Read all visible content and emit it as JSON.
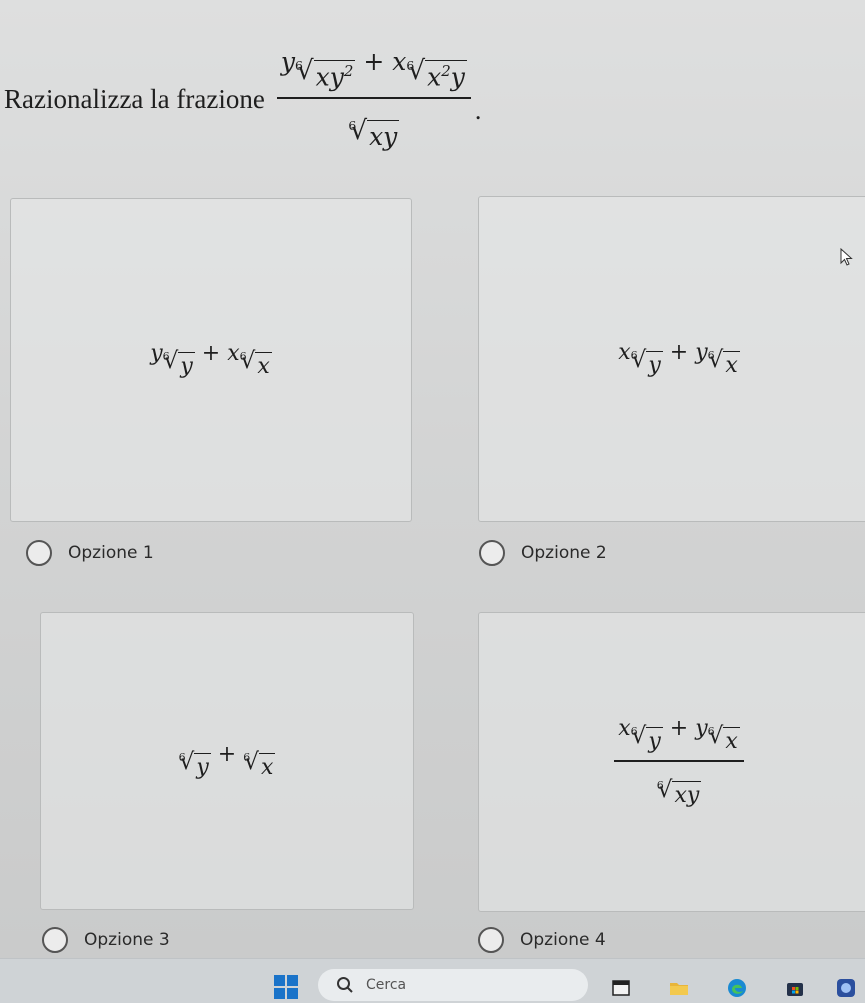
{
  "question": {
    "text": "Razionalizza la frazione",
    "fraction": {
      "numerator": {
        "coef1": "y",
        "rad1_index": "6",
        "rad1_arg": "xy",
        "rad1_exp": "2",
        "plus": "+",
        "coef2": "x",
        "rad2_index": "6",
        "rad2_arg_base": "x",
        "rad2_exp": "2",
        "rad2_arg_tail": "y"
      },
      "denominator": {
        "index": "6",
        "arg": "xy"
      }
    },
    "period": "."
  },
  "options": [
    {
      "label": "Opzione 1",
      "expr": {
        "c1": "y",
        "i1": "6",
        "a1": "y",
        "op": "+",
        "c2": "x",
        "i2": "6",
        "a2": "x"
      }
    },
    {
      "label": "Opzione 2",
      "expr": {
        "c1": "x",
        "i1": "6",
        "a1": "y",
        "op": "+",
        "c2": "y",
        "i2": "6",
        "a2": "x"
      }
    },
    {
      "label": "Opzione 3",
      "expr": {
        "i1": "6",
        "a1": "y",
        "op": "+",
        "i2": "6",
        "a2": "x"
      }
    },
    {
      "label": "Opzione 4",
      "expr": {
        "c1": "x",
        "i1": "6",
        "a1": "y",
        "op": "+",
        "c2": "y",
        "i2": "6",
        "a2": "x",
        "den_index": "6",
        "den_arg": "xy"
      }
    }
  ],
  "taskbar": {
    "search_label": "Cerca",
    "icons": [
      "windows-start-icon",
      "search-icon",
      "file-explorer-icon",
      "folder-icon",
      "edge-browser-icon",
      "store-icon",
      "app-icon"
    ]
  }
}
